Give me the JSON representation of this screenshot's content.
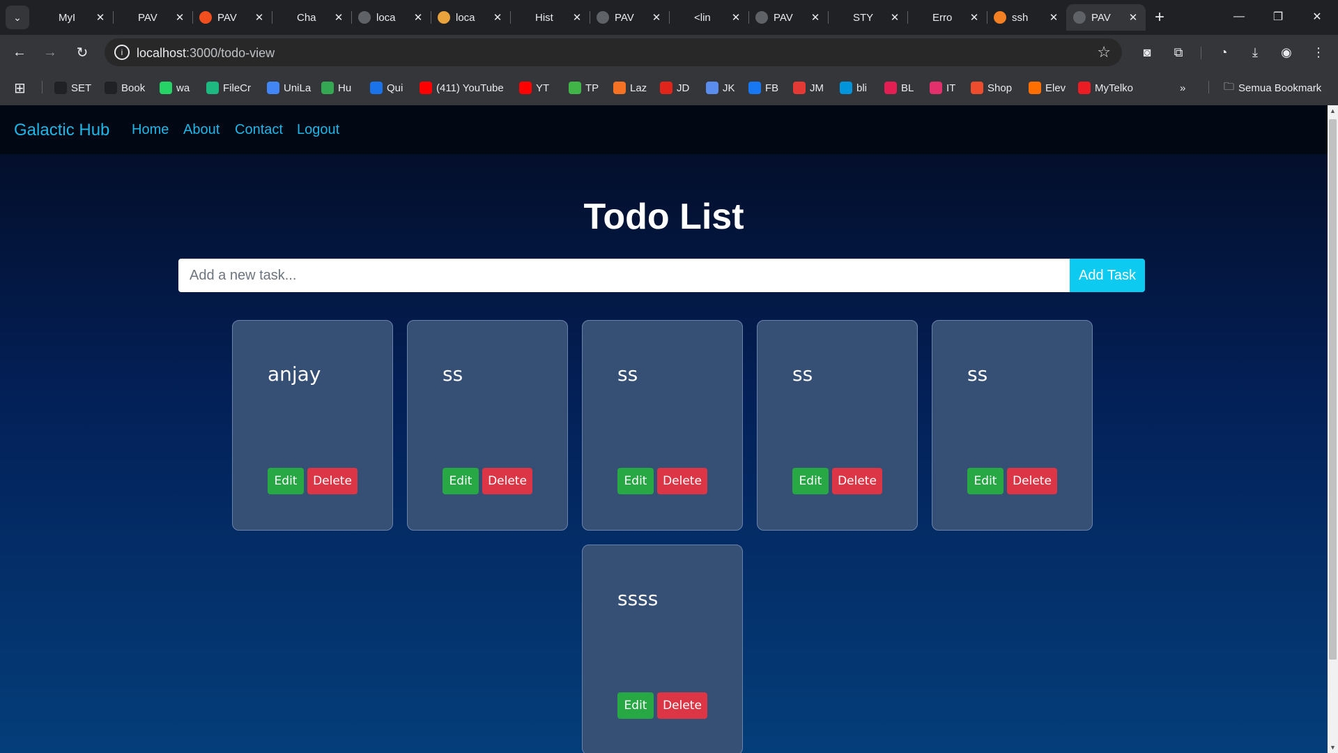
{
  "browser": {
    "tabs": [
      {
        "title": "MyI",
        "icon": "m-logo-icon",
        "color": "#202124"
      },
      {
        "title": "PAV",
        "icon": "m-logo-icon",
        "color": "#202124"
      },
      {
        "title": "PAV",
        "icon": "figma-icon",
        "color": "#f24e1e"
      },
      {
        "title": "Cha",
        "icon": "openai-icon",
        "color": "#202124"
      },
      {
        "title": "loca",
        "icon": "globe-icon",
        "color": "#5f6368"
      },
      {
        "title": "loca",
        "icon": "triangle-logo-icon",
        "color": "#e8a33d"
      },
      {
        "title": "Hist",
        "icon": "download-icon",
        "color": "#202124"
      },
      {
        "title": "PAV",
        "icon": "globe-icon",
        "color": "#5f6368"
      },
      {
        "title": "<lin",
        "icon": "sparkle-icon",
        "color": "#202124"
      },
      {
        "title": "PAV",
        "icon": "globe-icon",
        "color": "#5f6368"
      },
      {
        "title": "STY",
        "icon": "github-icon",
        "color": "#202124"
      },
      {
        "title": "Erro",
        "icon": "github-icon",
        "color": "#202124"
      },
      {
        "title": "ssh",
        "icon": "stackoverflow-icon",
        "color": "#f48024"
      },
      {
        "title": "PAV",
        "icon": "globe-icon",
        "color": "#5f6368"
      }
    ],
    "close_glyph": "✕",
    "new_tab_glyph": "+",
    "address": {
      "host": "localhost",
      "path": ":3000/todo-view"
    },
    "bookmarks": [
      {
        "label": "SET",
        "icon": "gear-icon",
        "color": "#202124"
      },
      {
        "label": "Book",
        "icon": "star-icon",
        "color": "#202124"
      },
      {
        "label": "wa",
        "icon": "whatsapp-icon",
        "color": "#25d366"
      },
      {
        "label": "FileCr",
        "icon": "filecr-icon",
        "color": "#1eb980"
      },
      {
        "label": "UniLa",
        "icon": "document-icon",
        "color": "#4285f4"
      },
      {
        "label": "Hu",
        "icon": "chat-icon",
        "color": "#34a853"
      },
      {
        "label": "Qui",
        "icon": "q-icon",
        "color": "#1a73e8"
      },
      {
        "label": "(411) YouTube",
        "icon": "youtube-icon",
        "color": "#ff0000"
      },
      {
        "label": "YT",
        "icon": "youtube-icon",
        "color": "#ff0000"
      },
      {
        "label": "TP",
        "icon": "tokopedia-icon",
        "color": "#42b549"
      },
      {
        "label": "Laz",
        "icon": "lazada-icon",
        "color": "#f57224"
      },
      {
        "label": "JD",
        "icon": "jd-icon",
        "color": "#e1251b"
      },
      {
        "label": "JK",
        "icon": "link-icon",
        "color": "#5b8def"
      },
      {
        "label": "FB",
        "icon": "facebook-icon",
        "color": "#1877f2"
      },
      {
        "label": "JM",
        "icon": "j-icon",
        "color": "#e53935"
      },
      {
        "label": "bli",
        "icon": "blibli-icon",
        "color": "#0095da"
      },
      {
        "label": "BL",
        "icon": "bukalapak-icon",
        "color": "#e31e52"
      },
      {
        "label": "IT",
        "icon": "instagram-icon",
        "color": "#e1306c"
      },
      {
        "label": "Shop",
        "icon": "shopee-icon",
        "color": "#ee4d2d"
      },
      {
        "label": "Elev",
        "icon": "elevenia-icon",
        "color": "#ff6f00"
      },
      {
        "label": "MyTelko",
        "icon": "telkomsel-icon",
        "color": "#ec1c24"
      }
    ],
    "bookmarks_more": "»",
    "all_bookmarks": "Semua Bookmark"
  },
  "app": {
    "brand": "Galactic Hub",
    "nav": [
      "Home",
      "About",
      "Contact",
      "Logout"
    ],
    "heading": "Todo List",
    "input_placeholder": "Add a new task...",
    "add_button": "Add Task",
    "edit_label": "Edit",
    "delete_label": "Delete",
    "todos": [
      "anjay",
      "ss",
      "ss",
      "ss",
      "ss",
      "ssss"
    ]
  }
}
